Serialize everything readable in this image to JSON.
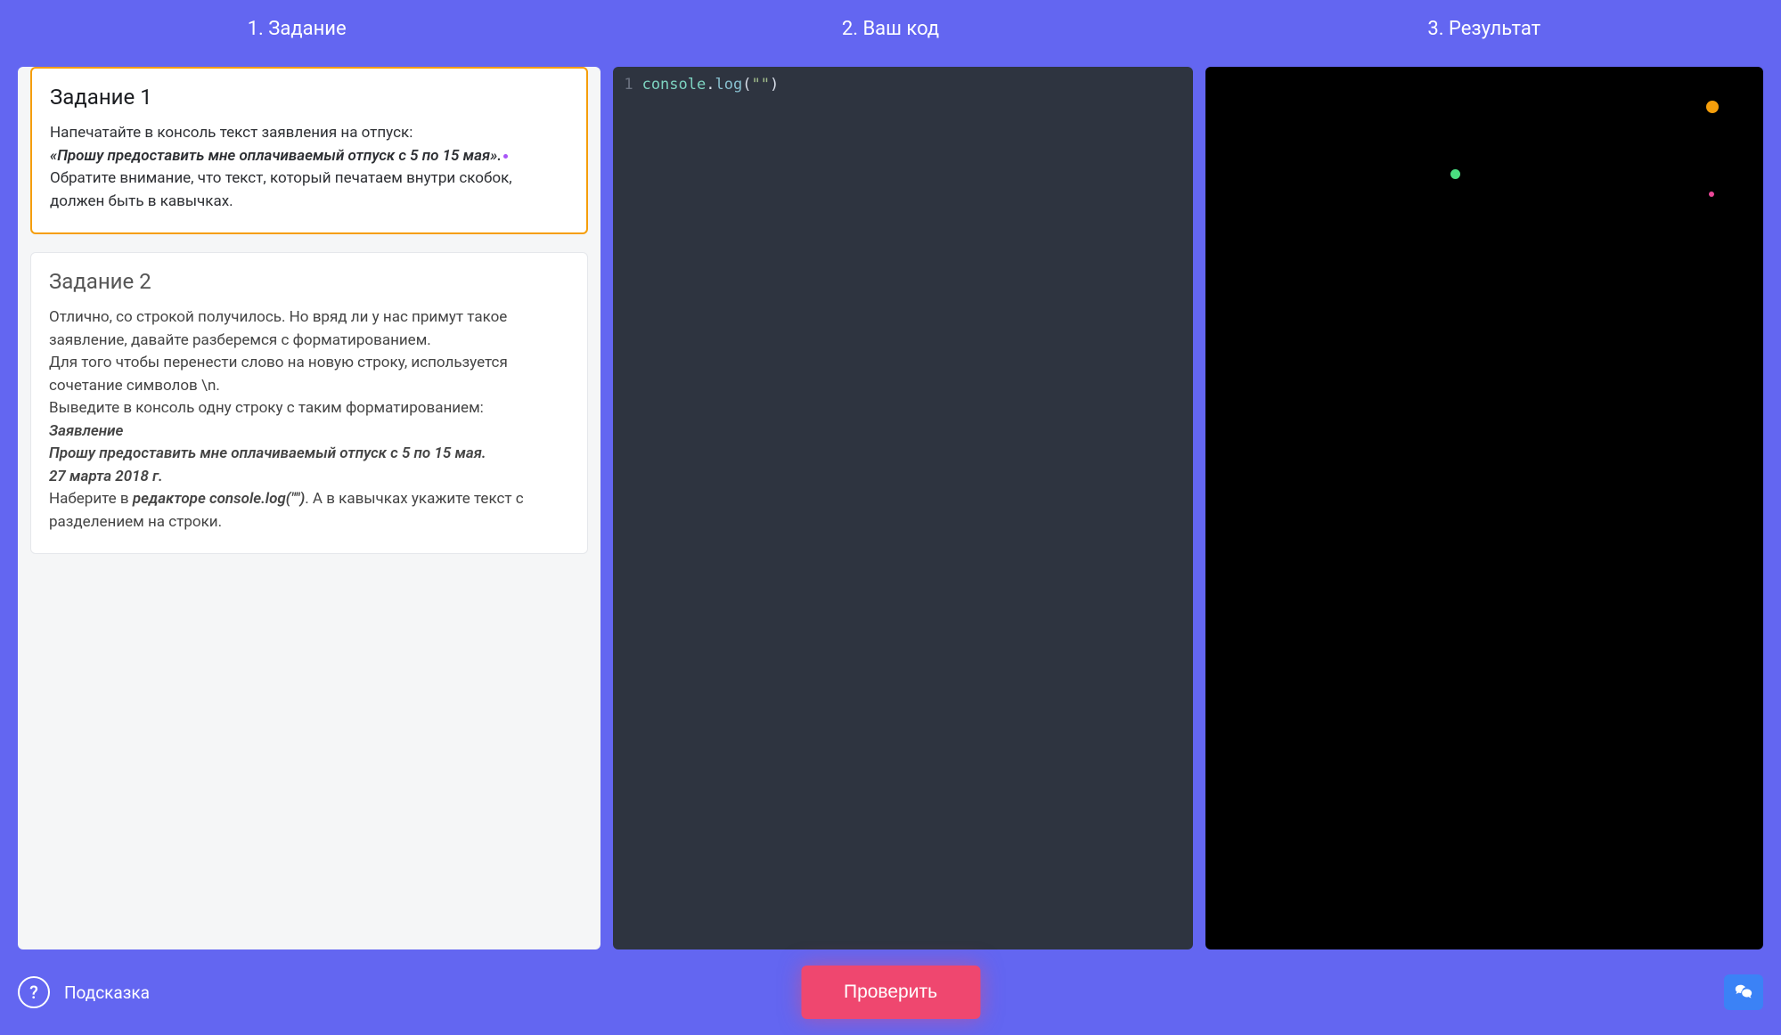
{
  "header": {
    "tab1": "1. Задание",
    "tab2": "2. Ваш код",
    "tab3": "3. Результат"
  },
  "tasks": [
    {
      "title": "Задание 1",
      "p1": "Напечатайте в консоль текст заявления на отпуск:",
      "em1": "«Прошу предоставить мне оплачиваемый отпуск с 5 по 15 мая».",
      "p2a": "Обратите внимание, что текст, который печатаем внутри скобок, должен быть в кавычках."
    },
    {
      "title": "Задание 2",
      "p1": "Отлично, со строкой получилось. Но вряд ли у нас примут такое заявление, давайте разберемся с форматированием.",
      "p2": "Для того чтобы перенести слово на новую строку, используется сочетание символов \\n.",
      "p3": "Выведите в консоль одну строку с таким форматированием:",
      "em1": "Заявление",
      "em2": "Прошу предоставить мне оплачиваемый отпуск с 5 по 15 мая.",
      "em3": "27 марта 2018 г.",
      "p4a": "Наберите в ",
      "p4em": "редакторе console.log(\"\")",
      "p4b": ". А в кавычках укажите текст с разделением на строки."
    }
  ],
  "code": {
    "lineNum": "1",
    "obj": "console",
    "dot": ".",
    "method": "log",
    "open": "(",
    "str": "\"\"",
    "close": ")"
  },
  "footer": {
    "hint_label": "Подсказка",
    "hint_symbol": "?",
    "check_label": "Проверить"
  }
}
